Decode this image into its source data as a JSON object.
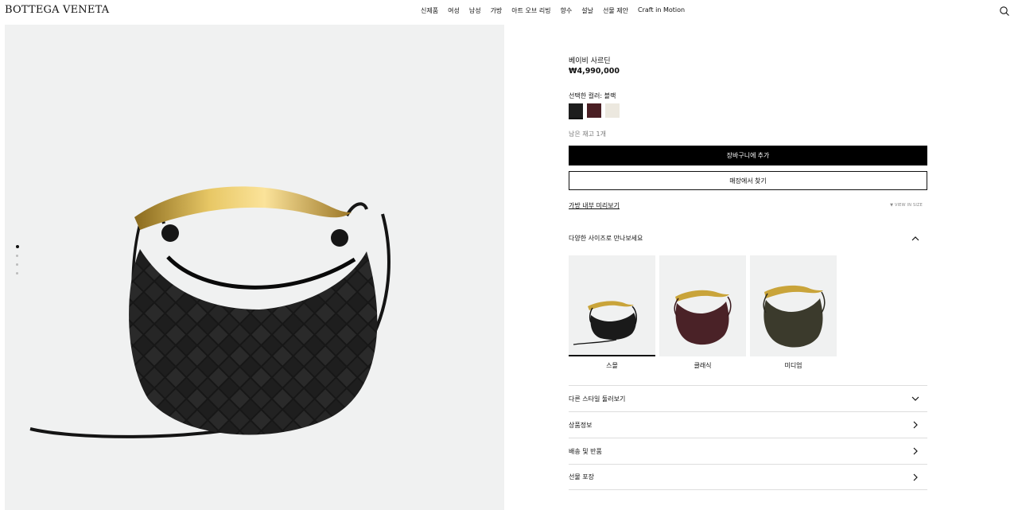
{
  "header": {
    "logo": "BOTTEGA VENETA",
    "nav": [
      "신제품",
      "여성",
      "남성",
      "가방",
      "아트 오브 리빙",
      "향수",
      "설날",
      "선물 제안",
      "Craft in Motion"
    ]
  },
  "product": {
    "name": "베이비 사르딘",
    "price": "₩4,990,000",
    "color_label": "선택한 컬러: 블랙",
    "swatches": [
      "#1d1d1d",
      "#4a1f24",
      "#ece8df"
    ],
    "stock": "남은 재고 1개",
    "add_to_cart": "장바구니에 추가",
    "find_in_store": "매장에서 찾기",
    "preview_link": "가방 내부 미리보기",
    "view_in_size": "▼ VIEW IN SIZE"
  },
  "sizes": {
    "title": "다양한 사이즈로 만나보세요",
    "items": [
      {
        "label": "스몰",
        "color": "#1a1a1a"
      },
      {
        "label": "클래식",
        "color": "#4a2227"
      },
      {
        "label": "미디엄",
        "color": "#3b3a2c"
      }
    ]
  },
  "accordion": [
    "다른 스타일 둘러보기",
    "상품정보",
    "배송 및 반품",
    "선물 포장"
  ],
  "colors": {
    "accent": "#000000",
    "image_bg": "#f0f1f1",
    "gold": "#c9a43a"
  }
}
